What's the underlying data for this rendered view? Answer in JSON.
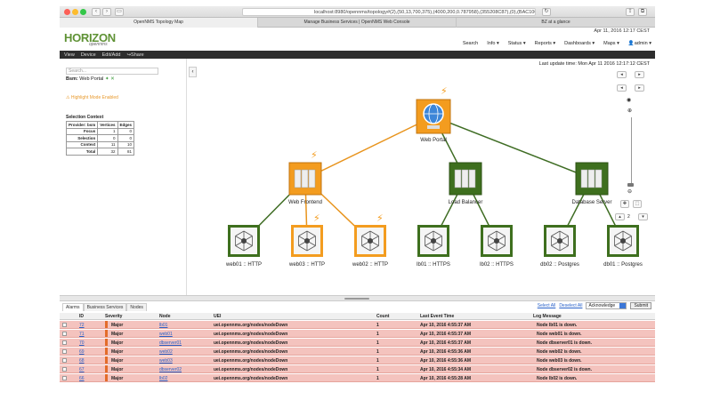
{
  "browser": {
    "url": "localhost:8980/opennms/topology#(2),(50,13,700,375),(4000,200,0.787958),(355208C87),(0),(BAC100)",
    "tabs": [
      {
        "label": "OpenNMS Topology Map",
        "active": true
      },
      {
        "label": "Manage Business Services | OpenNMS Web Console",
        "active": false
      },
      {
        "label": "BZ at a glance",
        "active": false
      }
    ]
  },
  "header": {
    "logo": "HORIZON",
    "logo_sub": "opennms",
    "datetime": "Apr 11, 2016 12:17 CEST",
    "menu": [
      "Search",
      "Info ▾",
      "Status ▾",
      "Reports ▾",
      "Dashboards ▾",
      "Maps ▾",
      "admin ▾"
    ]
  },
  "toolbar": {
    "items": [
      "View",
      "Device",
      "Edit/Add",
      "Share"
    ]
  },
  "left": {
    "search_placeholder": "Search...",
    "bsm_label": "Bsm:",
    "bsm_value": "Web Portal",
    "highlight_mode": "Highlight Mode Enabled",
    "selection_context_title": "Selection Context",
    "ctx_headers": [
      "Provider: bsm",
      "Vertices",
      "Edges"
    ],
    "ctx_rows": [
      [
        "Focus",
        "1",
        "0"
      ],
      [
        "Selection",
        "0",
        "0"
      ],
      [
        "Context",
        "11",
        "10"
      ],
      [
        "Total",
        "32",
        "81"
      ]
    ]
  },
  "canvas": {
    "last_update": "Last update time: Mon Apr 11 2016 12:17:12 CEST",
    "zoom_level": "2",
    "nodes": {
      "root": "Web Portal",
      "mid": [
        "Web Frontend",
        "Load Balancer",
        "Database Server"
      ],
      "leaves": [
        "web01 :: HTTP",
        "web03 :: HTTP",
        "web02 :: HTTP",
        "lb01 :: HTTPS",
        "lb02 :: HTTPS",
        "db02 :: Postgres",
        "db01 :: Postgres"
      ]
    },
    "colors": {
      "major": "#f39c1f",
      "normal": "#3e6f1e",
      "edge_major": "#e8941d",
      "edge_normal": "#3f6d24"
    }
  },
  "bottom": {
    "tabs": [
      "Alarms",
      "Business Services",
      "Nodes"
    ],
    "select_all": "Select All",
    "deselect_all": "Deselect All",
    "ack_value": "Acknowledge",
    "submit": "Submit",
    "columns": [
      "ID",
      "Severity",
      "Node",
      "UEI",
      "Count",
      "Last Event Time",
      "Log Message"
    ],
    "rows": [
      {
        "id": "72",
        "severity": "Major",
        "node": "lb01",
        "uei": "uei.opennms.org/nodes/nodeDown",
        "count": "1",
        "time": "Apr 10, 2016 4:55:37 AM",
        "msg": "Node lb01 is down."
      },
      {
        "id": "71",
        "severity": "Major",
        "node": "web01",
        "uei": "uei.opennms.org/nodes/nodeDown",
        "count": "1",
        "time": "Apr 10, 2016 4:55:37 AM",
        "msg": "Node web01 is down."
      },
      {
        "id": "70",
        "severity": "Major",
        "node": "dbserver01",
        "uei": "uei.opennms.org/nodes/nodeDown",
        "count": "1",
        "time": "Apr 10, 2016 4:55:37 AM",
        "msg": "Node dbserver01 is down."
      },
      {
        "id": "69",
        "severity": "Major",
        "node": "web02",
        "uei": "uei.opennms.org/nodes/nodeDown",
        "count": "1",
        "time": "Apr 10, 2016 4:55:36 AM",
        "msg": "Node web02 is down."
      },
      {
        "id": "68",
        "severity": "Major",
        "node": "web03",
        "uei": "uei.opennms.org/nodes/nodeDown",
        "count": "1",
        "time": "Apr 10, 2016 4:55:36 AM",
        "msg": "Node web03 is down."
      },
      {
        "id": "67",
        "severity": "Major",
        "node": "dbserver02",
        "uei": "uei.opennms.org/nodes/nodeDown",
        "count": "1",
        "time": "Apr 10, 2016 4:55:34 AM",
        "msg": "Node dbserver02 is down."
      },
      {
        "id": "66",
        "severity": "Major",
        "node": "lb02",
        "uei": "uei.opennms.org/nodes/nodeDown",
        "count": "1",
        "time": "Apr 10, 2016 4:55:28 AM",
        "msg": "Node lb02 is down."
      }
    ]
  }
}
